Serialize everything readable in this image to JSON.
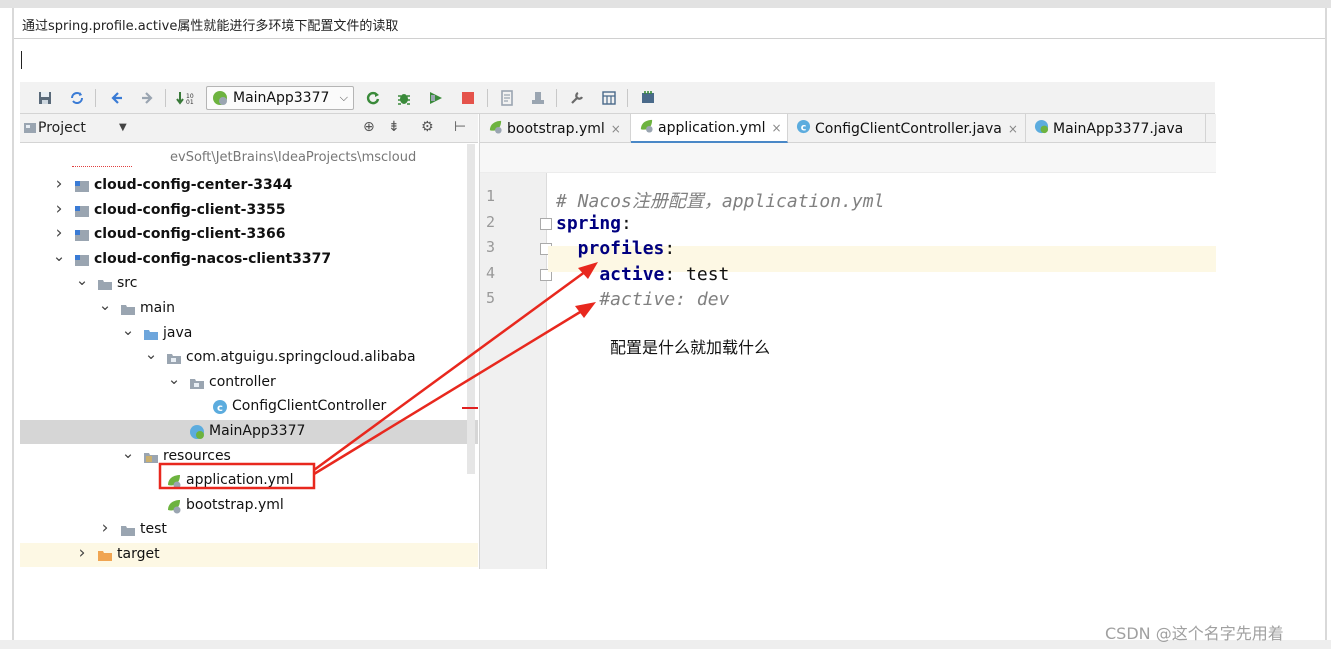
{
  "document": {
    "title": "通过spring.profile.active属性就能进行多环境下配置文件的读取",
    "watermark": "CSDN @这个名字先用着"
  },
  "toolbar": {
    "run_configuration": "MainApp3377",
    "icons": [
      "save-icon",
      "sync-icon",
      "back-icon",
      "forward-icon",
      "build-icon",
      "run-icon",
      "debug-icon",
      "coverage-icon",
      "stop-icon",
      "project-structure-icon",
      "sdk-icon",
      "settings-icon",
      "structure-icon",
      "terminal-icon"
    ]
  },
  "project": {
    "title": "Project",
    "path": "evSoft\\JetBrains\\IdeaProjects\\mscloud",
    "tree": [
      {
        "label": "cloud-config-center-3344",
        "depth": 0,
        "expanded": false,
        "icon": "module",
        "bold": true
      },
      {
        "label": "cloud-config-client-3355",
        "depth": 0,
        "expanded": false,
        "icon": "module",
        "bold": true
      },
      {
        "label": "cloud-config-client-3366",
        "depth": 0,
        "expanded": false,
        "icon": "module",
        "bold": true
      },
      {
        "label": "cloud-config-nacos-client3377",
        "depth": 0,
        "expanded": true,
        "icon": "module",
        "bold": true
      },
      {
        "label": "src",
        "depth": 1,
        "expanded": true,
        "icon": "folder-gray"
      },
      {
        "label": "main",
        "depth": 2,
        "expanded": true,
        "icon": "folder-gray"
      },
      {
        "label": "java",
        "depth": 3,
        "expanded": true,
        "icon": "folder-blue"
      },
      {
        "label": "com.atguigu.springcloud.alibaba",
        "depth": 4,
        "expanded": true,
        "icon": "package"
      },
      {
        "label": "controller",
        "depth": 5,
        "expanded": true,
        "icon": "package"
      },
      {
        "label": "ConfigClientController",
        "depth": 6,
        "icon": "class"
      },
      {
        "label": "MainApp3377",
        "depth": 5,
        "icon": "spring-class",
        "selected": true
      },
      {
        "label": "resources",
        "depth": 3,
        "expanded": true,
        "icon": "resources"
      },
      {
        "label": "application.yml",
        "depth": 4,
        "icon": "spring-yml",
        "boxed": true
      },
      {
        "label": "bootstrap.yml",
        "depth": 4,
        "icon": "spring-yml"
      },
      {
        "label": "test",
        "depth": 2,
        "expanded": false,
        "icon": "folder-gray"
      },
      {
        "label": "target",
        "depth": 1,
        "expanded": false,
        "icon": "folder-orange",
        "highlighted": true
      }
    ]
  },
  "editor": {
    "tabs": [
      {
        "label": "bootstrap.yml",
        "icon": "spring-yml",
        "active": false
      },
      {
        "label": "application.yml",
        "icon": "spring-yml",
        "active": true
      },
      {
        "label": "ConfigClientController.java",
        "icon": "class",
        "active": false
      },
      {
        "label": "MainApp3377.java",
        "icon": "spring-class",
        "active": false
      }
    ],
    "lines": [
      {
        "num": "1",
        "text": "# Nacos注册配置，application.yml"
      },
      {
        "num": "2",
        "key": "spring",
        "rest": ":"
      },
      {
        "num": "3",
        "key": "  profiles",
        "rest": ":"
      },
      {
        "num": "4",
        "key": "    active",
        "rest": ": test"
      },
      {
        "num": "5",
        "text": "    #active: dev"
      }
    ],
    "annotation": "配置是什么就加载什么"
  },
  "colors": {
    "arrow": "#e8281e",
    "selection": "#d6d6d6",
    "current_line": "#fdf8e4",
    "keyword": "#000080",
    "comment": "#808080"
  }
}
